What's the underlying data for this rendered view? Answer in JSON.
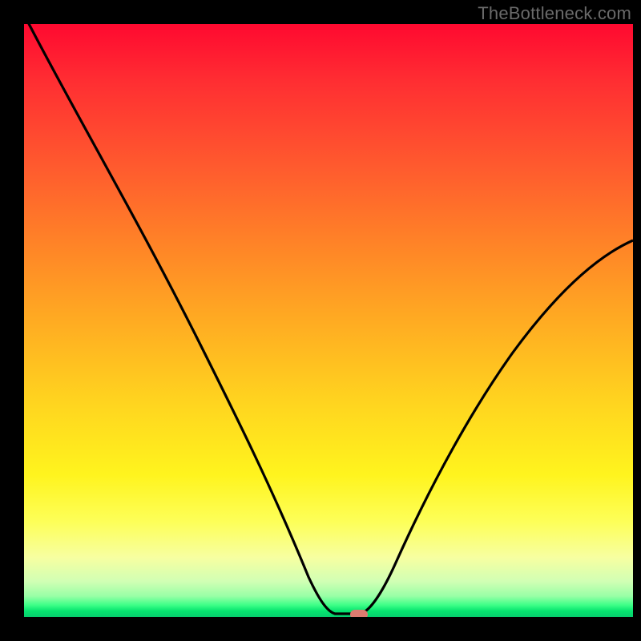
{
  "watermark": "TheBottleneck.com",
  "colors": {
    "frame_bg": "#000000",
    "curve_stroke": "#000000",
    "marker_fill": "#de7b70",
    "gradient_stops": [
      {
        "stop": 0.0,
        "hex": "#ff0930"
      },
      {
        "stop": 0.1,
        "hex": "#ff2f32"
      },
      {
        "stop": 0.24,
        "hex": "#ff5a2e"
      },
      {
        "stop": 0.37,
        "hex": "#ff8327"
      },
      {
        "stop": 0.5,
        "hex": "#ffab22"
      },
      {
        "stop": 0.63,
        "hex": "#ffd21f"
      },
      {
        "stop": 0.76,
        "hex": "#fff41e"
      },
      {
        "stop": 0.84,
        "hex": "#fdff59"
      },
      {
        "stop": 0.9,
        "hex": "#f7ffa1"
      },
      {
        "stop": 0.94,
        "hex": "#d1ffb4"
      },
      {
        "stop": 0.965,
        "hex": "#98ffa6"
      },
      {
        "stop": 0.98,
        "hex": "#3dff87"
      },
      {
        "stop": 0.99,
        "hex": "#06e46f"
      },
      {
        "stop": 1.0,
        "hex": "#06ce6e"
      }
    ]
  },
  "chart_data": {
    "type": "line",
    "title": "",
    "xlabel": "",
    "ylabel": "",
    "xlim": [
      0,
      100
    ],
    "ylim": [
      0,
      100
    ],
    "x": [
      0,
      5,
      10,
      15,
      20,
      25,
      30,
      35,
      40,
      45,
      50,
      52,
      54,
      56,
      58,
      60,
      65,
      70,
      75,
      80,
      85,
      90,
      95,
      100
    ],
    "values": [
      100,
      92,
      83,
      74,
      65,
      56,
      45,
      34,
      23,
      12,
      3,
      0.5,
      0,
      0.5,
      3,
      7,
      16,
      25,
      33,
      41,
      48,
      54,
      58,
      62
    ],
    "minimum_plateau_x": [
      50,
      56
    ],
    "marker": {
      "x": 54,
      "y": 0
    }
  }
}
